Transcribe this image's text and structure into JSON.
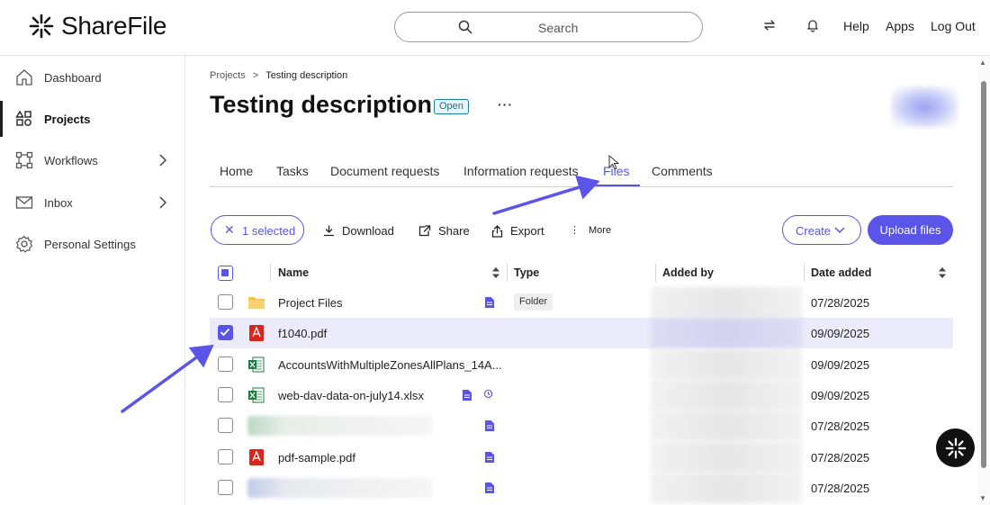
{
  "header": {
    "brand": "ShareFile",
    "search_placeholder": "Search",
    "links": [
      "Help",
      "Apps",
      "Log Out"
    ]
  },
  "sidebar": {
    "items": [
      {
        "label": "Dashboard",
        "icon": "home-icon"
      },
      {
        "label": "Projects",
        "icon": "projects-icon",
        "active": true
      },
      {
        "label": "Workflows",
        "icon": "workflows-icon",
        "has_submenu": true
      },
      {
        "label": "Inbox",
        "icon": "mail-icon",
        "has_submenu": true
      },
      {
        "label": "Personal Settings",
        "icon": "gear-icon"
      }
    ]
  },
  "breadcrumb": {
    "parent": "Projects",
    "separator": ">",
    "current": "Testing description"
  },
  "project": {
    "title": "Testing description",
    "status": "Open",
    "more": "···"
  },
  "tabs": [
    "Home",
    "Tasks",
    "Document requests",
    "Information requests",
    "Files",
    "Comments"
  ],
  "active_tab": "Files",
  "toolbar": {
    "selected": "1 selected",
    "download": "Download",
    "share": "Share",
    "export": "Export",
    "more": "More",
    "create": "Create",
    "upload": "Upload files"
  },
  "table": {
    "columns": [
      "Name",
      "Type",
      "Added by",
      "Date added"
    ],
    "rows": [
      {
        "name": "Project Files",
        "icon": "folder-icon",
        "type": "Folder",
        "date": "07/28/2025",
        "checked": false
      },
      {
        "name": "f1040.pdf",
        "icon": "pdf-icon",
        "type": "",
        "date": "09/09/2025",
        "checked": true
      },
      {
        "name": "AccountsWithMultipleZonesAllPlans_14A...",
        "icon": "excel-icon",
        "type": "",
        "date": "09/09/2025",
        "checked": false
      },
      {
        "name": "web-dav-data-on-july14.xlsx",
        "icon": "excel-icon",
        "type": "",
        "date": "09/09/2025",
        "checked": false
      },
      {
        "name": "",
        "icon": "blurred",
        "type": "",
        "date": "07/28/2025",
        "checked": false
      },
      {
        "name": "pdf-sample.pdf",
        "icon": "pdf-icon",
        "type": "",
        "date": "07/28/2025",
        "checked": false
      },
      {
        "name": "",
        "icon": "blurred",
        "type": "",
        "date": "07/28/2025",
        "checked": false
      }
    ]
  },
  "colors": {
    "accent": "#5a54e8",
    "selected_row": "#ecebfb",
    "pdf_red": "#d7261e",
    "excel_green": "#1d7a43",
    "folder_yellow": "#f2c14e"
  }
}
